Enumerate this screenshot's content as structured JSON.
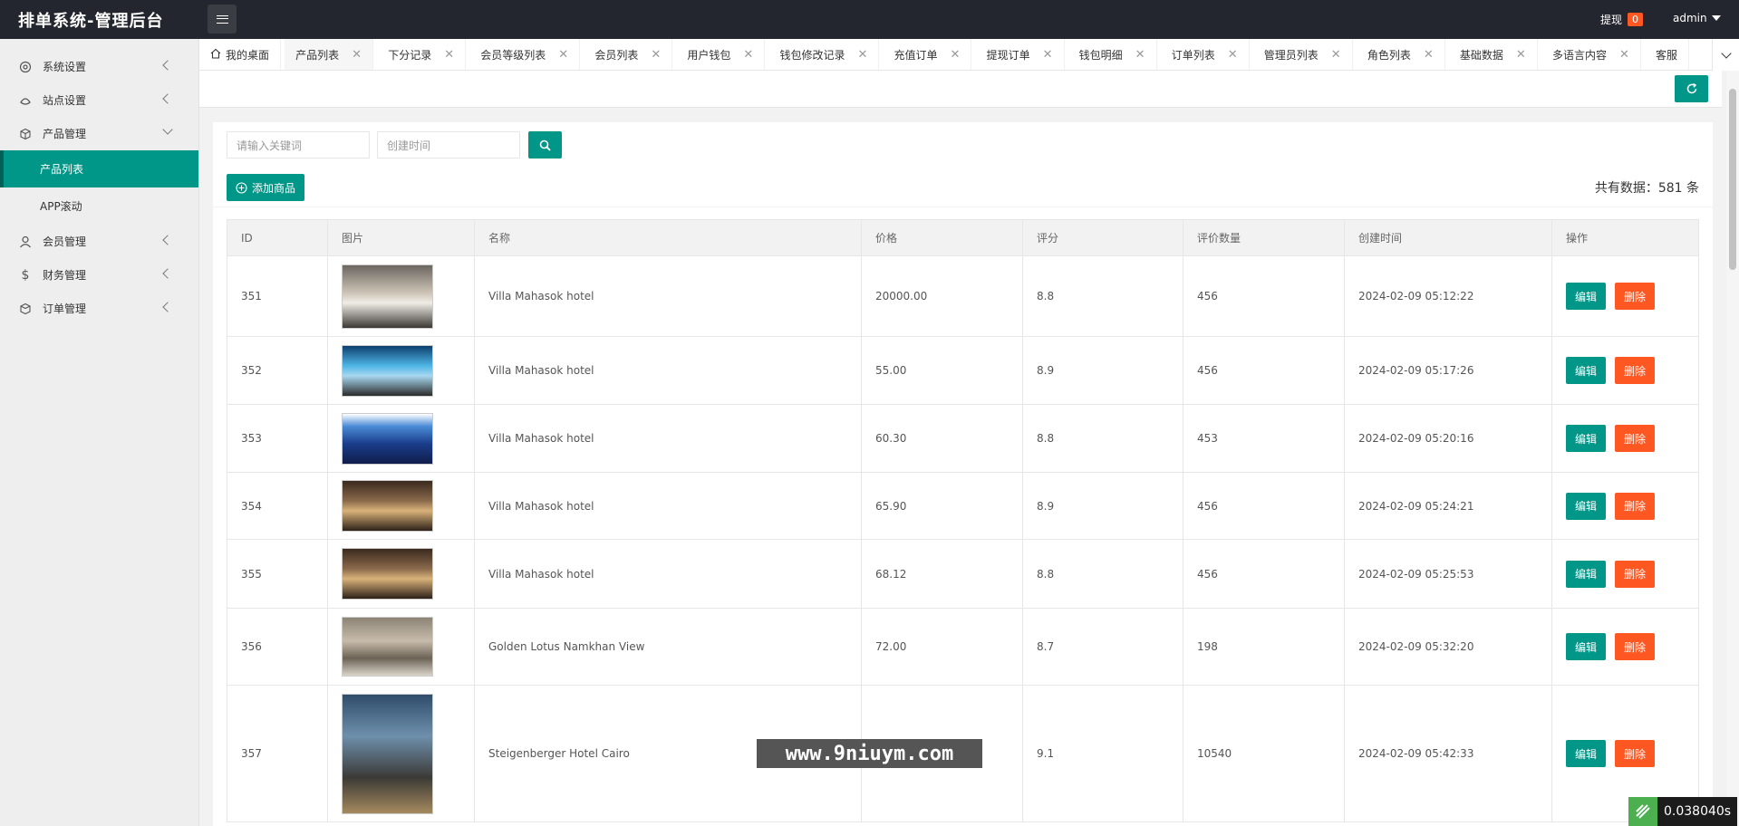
{
  "header": {
    "title": "排单系统-管理后台",
    "withdraw_label": "提现",
    "withdraw_count": "0",
    "user": "admin"
  },
  "sidebar": {
    "items": [
      {
        "label": "系统设置",
        "icon": "gear-icon"
      },
      {
        "label": "站点设置",
        "icon": "site-icon"
      },
      {
        "label": "产品管理",
        "icon": "box-icon"
      },
      {
        "label": "会员管理",
        "icon": "user-icon"
      },
      {
        "label": "财务管理",
        "icon": "dollar-icon"
      },
      {
        "label": "订单管理",
        "icon": "order-icon"
      }
    ],
    "sub_items": [
      "产品列表",
      "APP滚动"
    ]
  },
  "tabs": [
    "我的桌面",
    "产品列表",
    "下分记录",
    "会员等级列表",
    "会员列表",
    "用户钱包",
    "钱包修改记录",
    "充值订单",
    "提现订单",
    "钱包明细",
    "订单列表",
    "管理员列表",
    "角色列表",
    "基础数据",
    "多语言内容",
    "客服"
  ],
  "search": {
    "keyword_placeholder": "请输入关键词",
    "date_placeholder": "创建时间"
  },
  "toolbar": {
    "add_label": "添加商品",
    "total_label": "共有数据：581 条"
  },
  "table": {
    "columns": [
      "ID",
      "图片",
      "名称",
      "价格",
      "评分",
      "评价数量",
      "创建时间",
      "操作"
    ],
    "rows": [
      {
        "id": "351",
        "name": "Villa Mahasok hotel",
        "price": "20000.00",
        "score": "8.8",
        "reviews": "456",
        "created": "2024-02-09 05:12:22"
      },
      {
        "id": "352",
        "name": "Villa Mahasok hotel",
        "price": "55.00",
        "score": "8.9",
        "reviews": "456",
        "created": "2024-02-09 05:17:26"
      },
      {
        "id": "353",
        "name": "Villa Mahasok hotel",
        "price": "60.30",
        "score": "8.8",
        "reviews": "453",
        "created": "2024-02-09 05:20:16"
      },
      {
        "id": "354",
        "name": "Villa Mahasok hotel",
        "price": "65.90",
        "score": "8.9",
        "reviews": "456",
        "created": "2024-02-09 05:24:21"
      },
      {
        "id": "355",
        "name": "Villa Mahasok hotel",
        "price": "68.12",
        "score": "8.8",
        "reviews": "456",
        "created": "2024-02-09 05:25:53"
      },
      {
        "id": "356",
        "name": "Golden Lotus Namkhan View",
        "price": "72.00",
        "score": "8.7",
        "reviews": "198",
        "created": "2024-02-09 05:32:20"
      },
      {
        "id": "357",
        "name": "Steigenberger Hotel Cairo",
        "price": "",
        "score": "9.1",
        "reviews": "10540",
        "created": "2024-02-09 05:42:33"
      }
    ],
    "edit_label": "编辑",
    "delete_label": "删除"
  },
  "watermark": "www.9niuym.com",
  "timer": "0.038040s",
  "colors": {
    "primary": "#009688",
    "danger": "#ff5722",
    "header": "#23262e"
  }
}
